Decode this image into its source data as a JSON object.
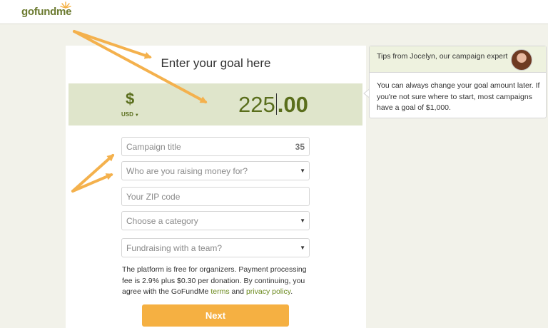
{
  "brand": {
    "logo_go": "go",
    "logo_fund": "fund",
    "logo_me": "me",
    "logo_name": "gofundme"
  },
  "goal": {
    "heading": "Enter your goal here",
    "currency_symbol": "$",
    "currency_code": "USD",
    "amount_integer": "225",
    "amount_cents": ".00"
  },
  "form": {
    "campaign_title": {
      "placeholder": "Campaign title",
      "char_count": "35"
    },
    "raising_for": {
      "placeholder": "Who are you raising money for?"
    },
    "zip": {
      "placeholder": "Your ZIP code"
    },
    "category": {
      "placeholder": "Choose a category"
    },
    "team": {
      "placeholder": "Fundraising with a team?"
    }
  },
  "disclaimer": {
    "text_before": "The platform is free for organizers. Payment processing fee is 2.9% plus $0.30 per donation. By continuing, you agree with the GoFundMe ",
    "terms_link": "terms",
    "and": " and ",
    "privacy_link": "privacy policy",
    "end": "."
  },
  "next_button": {
    "label": "Next"
  },
  "tips": {
    "title": "Tips from Jocelyn, our campaign expert",
    "body": "You can always change your goal amount later. If you're not sure where to start, most campaigns have a goal of $1,000."
  },
  "colors": {
    "brand_green": "#5a6e1c",
    "band": "#dfe5cb",
    "next": "#f5b042",
    "arrow": "#f4b14d"
  },
  "icons": [
    "sun-logo-icon",
    "chevron-down-icon",
    "avatar-icon"
  ]
}
